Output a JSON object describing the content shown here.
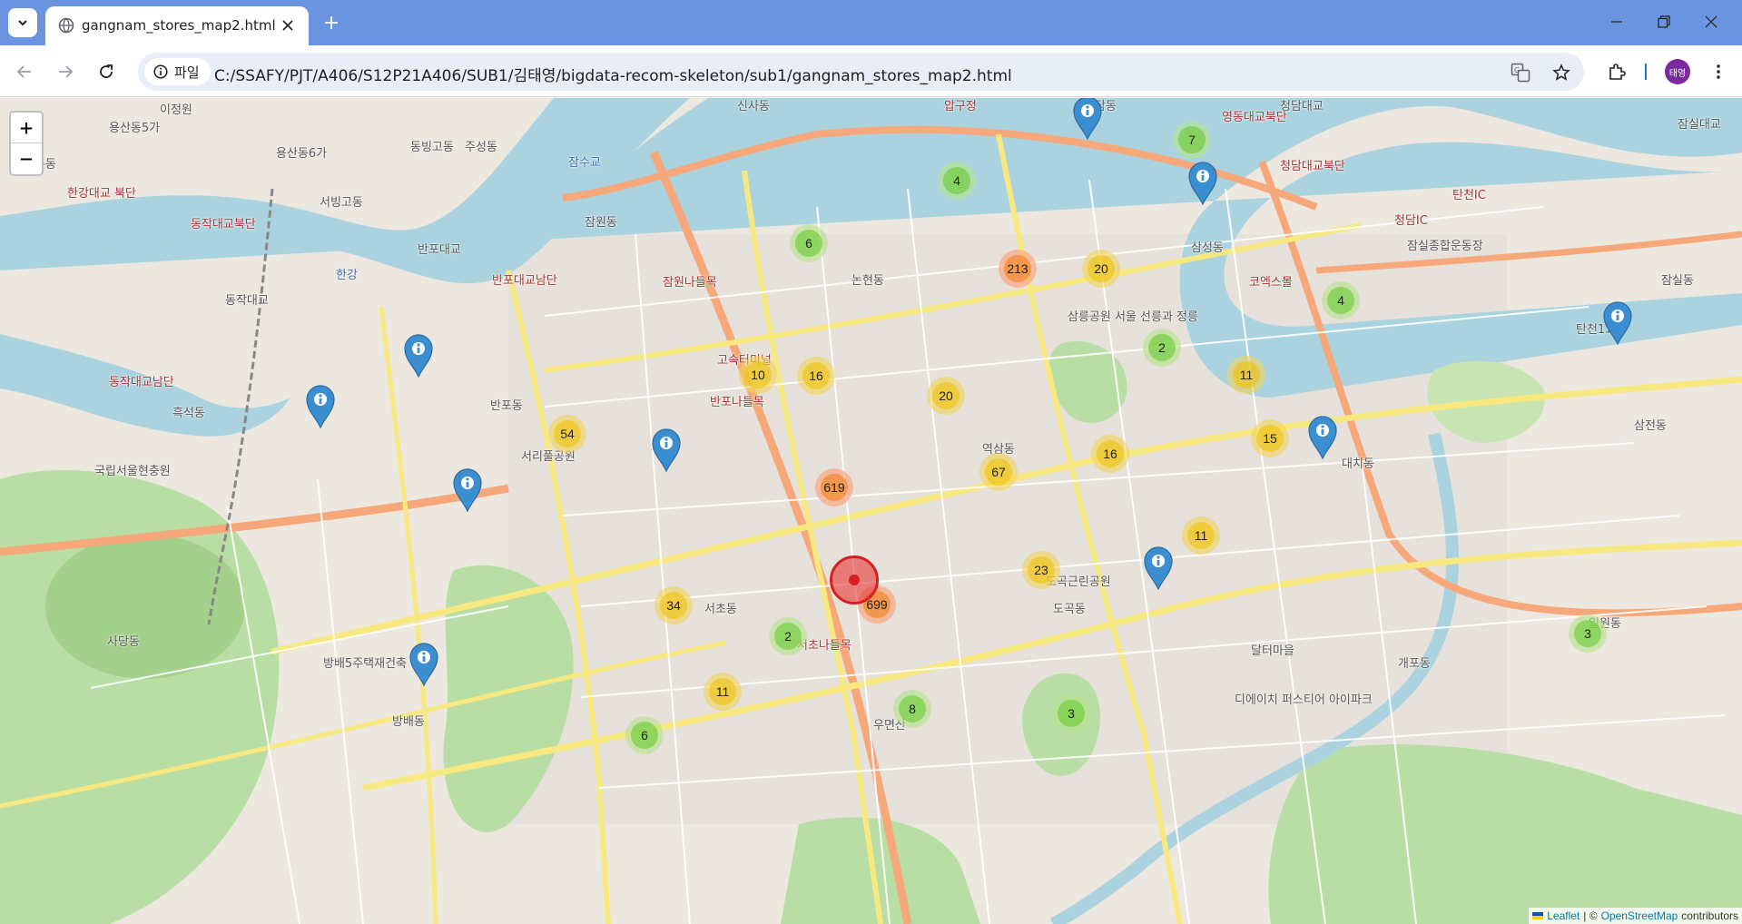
{
  "browser": {
    "tab_title": "gangnam_stores_map2.html",
    "chip_label": "파일",
    "url": "C:/SSAFY/PJT/A406/S12P21A406/SUB1/김태영/bigdata-recom-skeleton/sub1/gangnam_stores_map2.html",
    "profile_initials": "태영"
  },
  "map": {
    "zoom_in": "+",
    "zoom_out": "−",
    "attribution": {
      "leaflet": "Leaflet",
      "separator": "| ©",
      "osm": "OpenStreetMap",
      "contributors": "contributors"
    },
    "clusters": [
      {
        "count": "7",
        "size": "small"
      },
      {
        "count": "4",
        "size": "small"
      },
      {
        "count": "6",
        "size": "small"
      },
      {
        "count": "213",
        "size": "large"
      },
      {
        "count": "20",
        "size": "medium"
      },
      {
        "count": "4",
        "size": "small"
      },
      {
        "count": "2",
        "size": "small"
      },
      {
        "count": "11",
        "size": "medium"
      },
      {
        "count": "10",
        "size": "medium"
      },
      {
        "count": "16",
        "size": "medium"
      },
      {
        "count": "20",
        "size": "medium"
      },
      {
        "count": "54",
        "size": "medium"
      },
      {
        "count": "16",
        "size": "medium"
      },
      {
        "count": "15",
        "size": "medium"
      },
      {
        "count": "67",
        "size": "medium"
      },
      {
        "count": "619",
        "size": "large"
      },
      {
        "count": "699",
        "size": "large"
      },
      {
        "count": "11",
        "size": "medium"
      },
      {
        "count": "23",
        "size": "medium"
      },
      {
        "count": "34",
        "size": "medium"
      },
      {
        "count": "2",
        "size": "small"
      },
      {
        "count": "3",
        "size": "small"
      },
      {
        "count": "11",
        "size": "medium"
      },
      {
        "count": "8",
        "size": "small"
      },
      {
        "count": "3",
        "size": "small"
      },
      {
        "count": "6",
        "size": "small"
      }
    ],
    "place_labels": [
      "이정원",
      "용산동5가",
      "용산동6가",
      "서빙고동",
      "동빙고동",
      "주성동",
      "이촌동",
      "한강대교 북단",
      "반포대교",
      "동작대교",
      "동작대교북단",
      "반포대교남단",
      "신사동",
      "잠원동",
      "잠원나들목",
      "논현동",
      "청담동",
      "청담대교",
      "삼성동",
      "코엑스몰",
      "잠실동",
      "잠실대교",
      "반포동",
      "반포나들목",
      "역삼동",
      "대치동",
      "삼전동",
      "서초동",
      "도곡동",
      "개포동",
      "일원동",
      "방배동",
      "사당동",
      "국립서울현충원",
      "흑석동",
      "서초나들목",
      "달터마을",
      "동작대교남단",
      "잠실종합운동장",
      "디에이치 퍼스티어 아이파크",
      "압구정",
      "영동대교북단",
      "청담대교북단",
      "잠수교",
      "고속터미널",
      "삼릉공원 서울 선릉과 정릉",
      "청담IC",
      "탄천IC",
      "탄천1교",
      "한강",
      "도곡근린공원",
      "방배5주택재건축",
      "서리풀공원",
      "우면산"
    ]
  }
}
